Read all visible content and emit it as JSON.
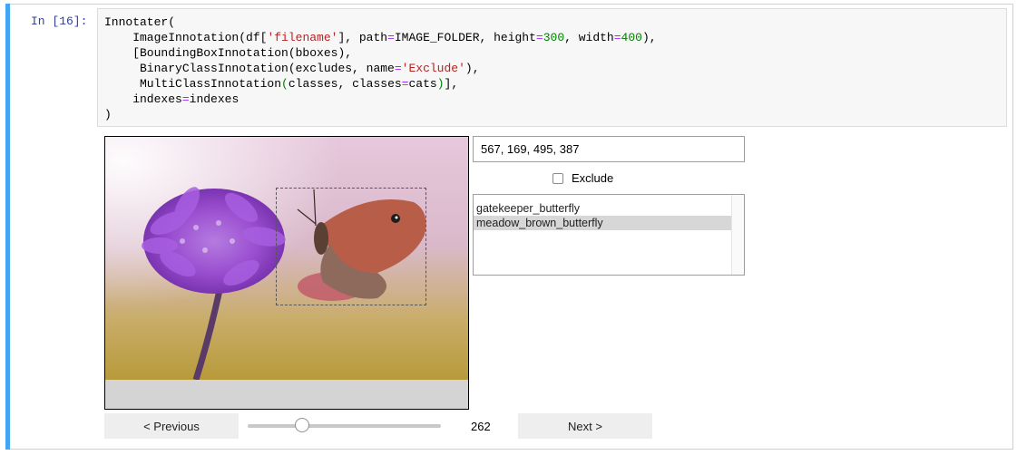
{
  "cell": {
    "prompt": "In [16]:",
    "code_lines": {
      "l1": "Innotater(",
      "l2a": "    ImageInnotation(df[",
      "l2b": "'filename'",
      "l2c": "], path",
      "l2d": "=",
      "l2e": "IMAGE_FOLDER, height",
      "l2f": "=",
      "l2g": "300",
      "l2h": ", width",
      "l2i": "=",
      "l2j": "400",
      "l2k": "),",
      "l3": "    [BoundingBoxInnotation(bboxes),",
      "l4a": "     BinaryClassInnotation(excludes, name",
      "l4b": "=",
      "l4c": "'Exclude'",
      "l4d": "),",
      "l5a": "     MultiClassInnotation",
      "l5b": "(",
      "l5c": "classes, classes",
      "l5d": "=",
      "l5e": "cats",
      "l5f": ")",
      "l5g": "],",
      "l6a": "    indexes",
      "l6b": "=",
      "l6c": "indexes",
      "l7": ")"
    }
  },
  "widget": {
    "image_alt": "butterfly on purple flower",
    "bbox_value": "567, 169, 495, 387",
    "exclude_label": "Exclude",
    "exclude_checked": false,
    "classes": [
      {
        "label": "gatekeeper_butterfly",
        "selected": false
      },
      {
        "label": "meadow_brown_butterfly",
        "selected": true
      }
    ],
    "prev_label": "< Previous",
    "next_label": "Next >",
    "index": "262"
  },
  "colors": {
    "cell_accent": "#42a5f5",
    "prompt": "#303f9f",
    "string": "#ba2121",
    "number": "#008000",
    "operator": "#aa22ff"
  }
}
